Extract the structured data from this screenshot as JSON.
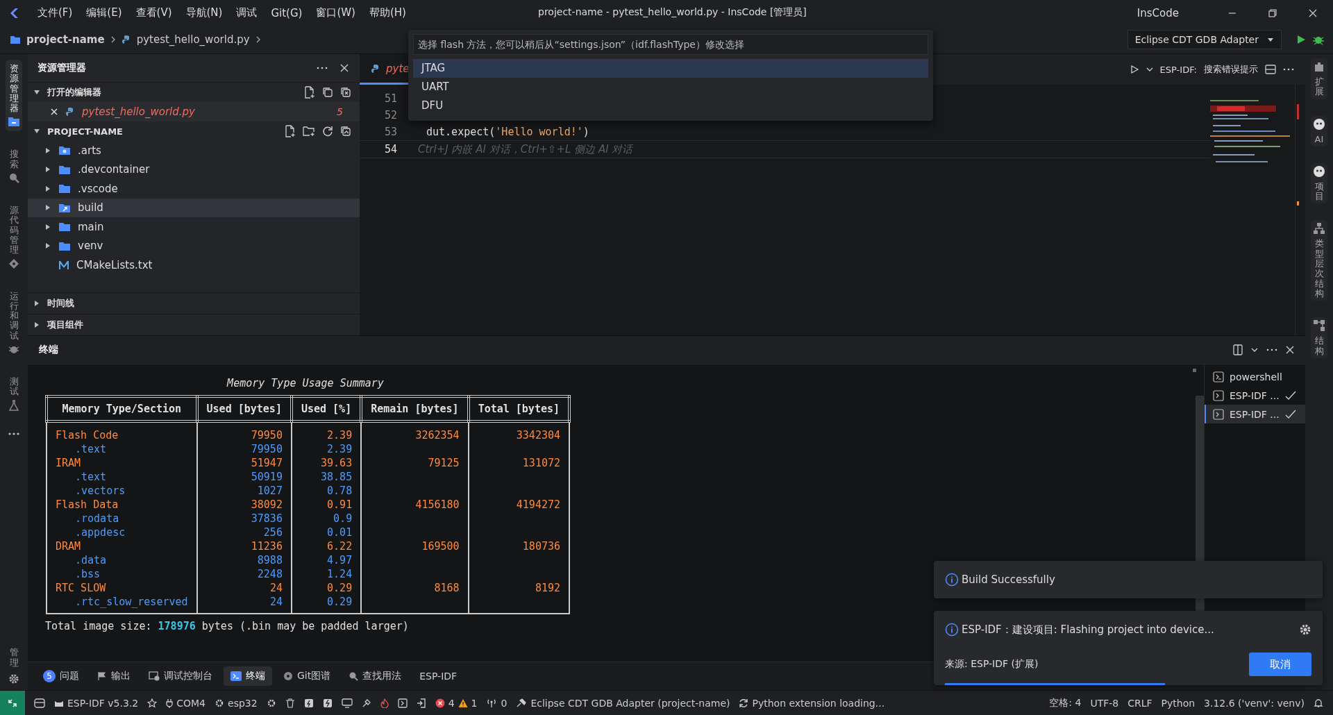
{
  "menu": [
    "文件(F)",
    "编辑(E)",
    "查看(V)",
    "导航(N)",
    "调试",
    "Git(G)",
    "窗口(W)",
    "帮助(H)"
  ],
  "window": {
    "title": "project-name - pytest_hello_world.py - InsCode [管理员]",
    "app": "InsCode"
  },
  "breadcrumb": [
    "project-name",
    "pytest_hello_world.py"
  ],
  "debug_adapter": "Eclipse CDT GDB Adapter",
  "activity_left": [
    {
      "label": "资源管理器",
      "kind": "explorer",
      "selected": true
    },
    {
      "label": "搜索",
      "kind": "search",
      "selected": false
    },
    {
      "label": "源代码管理",
      "kind": "git",
      "selected": false
    },
    {
      "label": "运行和调试",
      "kind": "debug",
      "selected": false
    },
    {
      "label": "测试",
      "kind": "test",
      "selected": false
    }
  ],
  "activity_manage": "管理",
  "activity_right": [
    {
      "label": "扩展",
      "kind": "extensions"
    },
    {
      "label": "AI",
      "kind": "ai"
    },
    {
      "label": "项目",
      "kind": "ai"
    },
    {
      "label": "类型层次结构",
      "kind": "hierarchy"
    },
    {
      "label": "结构",
      "kind": "structure"
    }
  ],
  "sidebar": {
    "title": "资源管理器",
    "open_editors": {
      "title": "打开的编辑器",
      "expanded": true,
      "items": [
        {
          "name": "pytest_hello_world.py",
          "problems": "5"
        }
      ]
    },
    "project": {
      "title": "PROJECT-NAME",
      "expanded": true,
      "items": [
        {
          "name": ".arts",
          "kind": "arts-folder",
          "selected": false
        },
        {
          "name": ".devcontainer",
          "kind": "folder",
          "selected": false
        },
        {
          "name": ".vscode",
          "kind": "folder",
          "selected": false
        },
        {
          "name": "build",
          "kind": "build-folder",
          "selected": true
        },
        {
          "name": "main",
          "kind": "folder",
          "selected": false
        },
        {
          "name": "venv",
          "kind": "folder",
          "selected": false
        },
        {
          "name": "CMakeLists.txt",
          "kind": "cmake",
          "selected": false
        }
      ]
    },
    "sections": [
      {
        "title": "时间线",
        "expanded": false
      },
      {
        "title": "项目组件",
        "expanded": false
      }
    ]
  },
  "editor": {
    "tab": "pyte",
    "toolbar_prefix": "ESP-IDF:",
    "toolbar_action": "搜索错误提示",
    "lines": [
      {
        "number": "51",
        "current": false
      },
      {
        "number": "52",
        "current": false
      },
      {
        "number": "53",
        "current": false,
        "tokens": [
          {
            "text": "dut.expect(",
            "kind": "plain"
          },
          {
            "text": "'Hello world!'",
            "kind": "string"
          },
          {
            "text": ")",
            "kind": "plain"
          }
        ]
      },
      {
        "number": "54",
        "current": true,
        "hint": "Ctrl+J 内嵌 AI 对话，Ctrl+⇧+L 侧边 AI 对话"
      }
    ]
  },
  "quick_pick": {
    "placeholder": "选择 flash 方法，您可以稍后从“settings.json”（idf.flashType）修改选择",
    "options": [
      {
        "label": "JTAG",
        "selected": true
      },
      {
        "label": "UART",
        "selected": false
      },
      {
        "label": "DFU",
        "selected": false
      }
    ]
  },
  "panel": {
    "title": "终端",
    "terminal": {
      "summary_title": "Memory Type Usage Summary",
      "columns": [
        "Memory Type/Section",
        "Used [bytes]",
        "Used [%]",
        "Remain [bytes]",
        "Total [bytes]"
      ],
      "rows": [
        {
          "name": "Flash Code",
          "kind": "type",
          "used": "79950",
          "percent": "2.39",
          "remain": "3262354",
          "total": "3342304"
        },
        {
          "name": ".text",
          "kind": "section",
          "used": "79950",
          "percent": "2.39"
        },
        {
          "name": "IRAM",
          "kind": "type",
          "used": "51947",
          "percent": "39.63",
          "remain": "79125",
          "total": "131072"
        },
        {
          "name": ".text",
          "kind": "section",
          "used": "50919",
          "percent": "38.85"
        },
        {
          "name": ".vectors",
          "kind": "section",
          "used": "1027",
          "percent": "0.78"
        },
        {
          "name": "Flash Data",
          "kind": "type",
          "used": "38092",
          "percent": "0.91",
          "remain": "4156180",
          "total": "4194272"
        },
        {
          "name": ".rodata",
          "kind": "section",
          "used": "37836",
          "percent": "0.9"
        },
        {
          "name": ".appdesc",
          "kind": "section",
          "used": "256",
          "percent": "0.01"
        },
        {
          "name": "DRAM",
          "kind": "type",
          "used": "11236",
          "percent": "6.22",
          "remain": "169500",
          "total": "180736"
        },
        {
          "name": ".data",
          "kind": "section",
          "used": "8988",
          "percent": "4.97"
        },
        {
          "name": ".bss",
          "kind": "section",
          "used": "2248",
          "percent": "1.24"
        },
        {
          "name": "RTC SLOW",
          "kind": "type",
          "used": "24",
          "percent": "0.29",
          "remain": "8168",
          "total": "8192"
        },
        {
          "name": ".rtc_slow_reserved",
          "kind": "section",
          "used": "24",
          "percent": "0.29"
        }
      ],
      "total": "Total image size: **178976** bytes (.bin may be padded larger)"
    },
    "sessions": [
      {
        "name": "powershell",
        "kind": "shell",
        "done": false,
        "selected": false
      },
      {
        "name": "ESP-IDF ...",
        "kind": "task",
        "done": true,
        "selected": false
      },
      {
        "name": "ESP-IDF ...",
        "kind": "task",
        "done": true,
        "selected": true
      }
    ]
  },
  "bottom_tabs": [
    {
      "label": "问题",
      "kind": "problems",
      "badge": "5",
      "selected": false
    },
    {
      "label": "输出",
      "kind": "output",
      "selected": false
    },
    {
      "label": "调试控制台",
      "kind": "debug-console",
      "selected": false
    },
    {
      "label": "终端",
      "kind": "terminal",
      "selected": true
    },
    {
      "label": "Git图谱",
      "kind": "git-graph",
      "selected": false
    },
    {
      "label": "查找用法",
      "kind": "find-usages",
      "selected": false
    },
    {
      "label": "ESP-IDF",
      "kind": "plain",
      "selected": false
    }
  ],
  "notifications": [
    {
      "message": "Build Successfully"
    },
    {
      "message": "ESP-IDF：建设项目: Flashing project into device...",
      "source": "来源: ESP-IDF (扩展)",
      "button": "取消",
      "busy": true
    }
  ],
  "status_bar": {
    "idf": "ESP-IDF v5.3.2",
    "port": "COM4",
    "target": "esp32",
    "errors": "4",
    "warnings": "1",
    "ports_forwarded": "0",
    "debug": "Eclipse CDT GDB Adapter (project-name)",
    "python_status": "Python extension loading...",
    "right": [
      "空格: 4",
      "UTF-8",
      "CRLF",
      "Python",
      "3.12.6 ('venv': venv)"
    ]
  }
}
